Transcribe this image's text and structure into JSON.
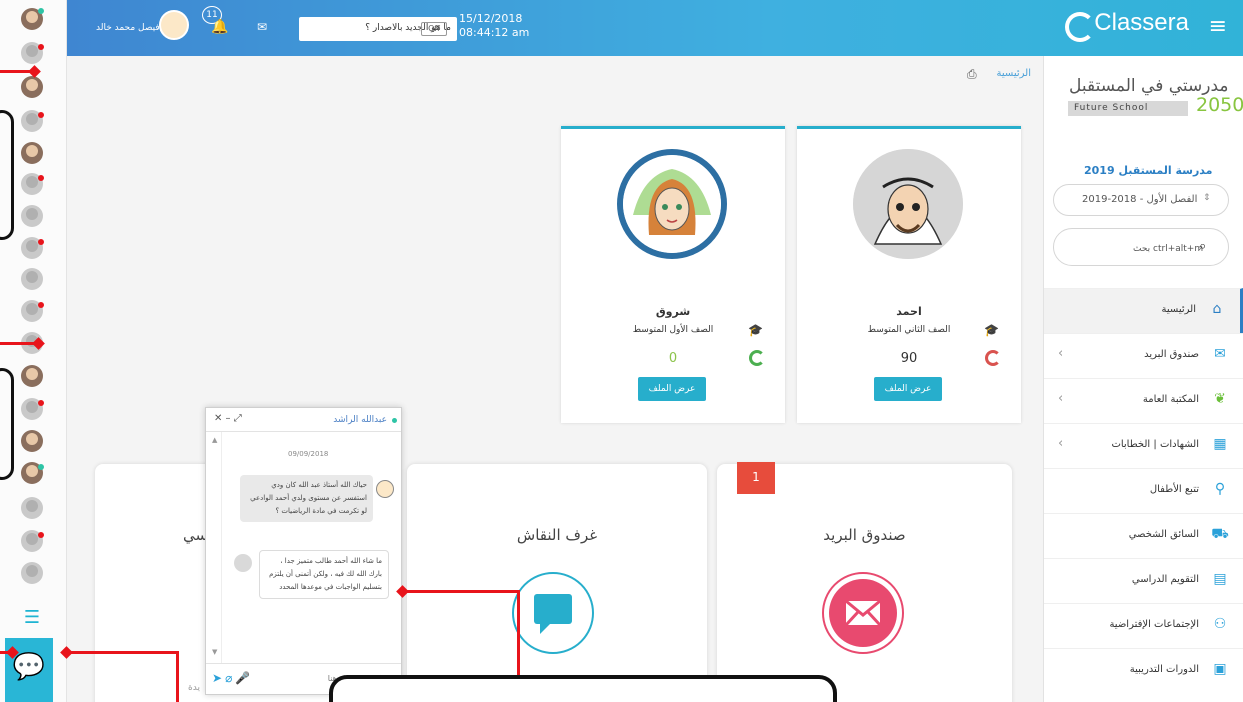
{
  "header": {
    "user_name": "فيصل محمد خالد",
    "notifications_count": "11",
    "whats_new_label": "ما هو الجديد بالاصدار ؟",
    "toggle_label": "Off",
    "date": "15/12/2018",
    "time": "08:44:12 am",
    "logo_text": "Classera",
    "accent_color": "#3fb0e0"
  },
  "sidebar": {
    "school_title_ar": "مدرستي في المستقبل",
    "school_title_en": "Future School",
    "school_year_badge": "2050",
    "school_name": "مدرسة المستقبل 2019",
    "term": "الفصل الأول - 2018-2019",
    "search_placeholder": "بحث ctrl+alt+m",
    "items": [
      {
        "label": "الرئيسية",
        "icon": "home-icon",
        "active": true
      },
      {
        "label": "صندوق البريد",
        "icon": "mail-icon"
      },
      {
        "label": "المكتبة العامة",
        "icon": "leaf-icon"
      },
      {
        "label": "الشهادات | الخطابات",
        "icon": "qr-icon"
      },
      {
        "label": "تتبع الأطفال",
        "icon": "location-pin-icon"
      },
      {
        "label": "السائق الشخصي",
        "icon": "car-icon"
      },
      {
        "label": "التقويم الدراسي",
        "icon": "calendar-icon"
      },
      {
        "label": "الإجتماعات الإفتراضية",
        "icon": "group-icon"
      },
      {
        "label": "الدورات التدريبية",
        "icon": "grid-icon"
      }
    ]
  },
  "main": {
    "breadcrumb": "الرئيسية",
    "children": [
      {
        "name": "احمد",
        "grade": "الصف الثاني المتوسط",
        "score": "90",
        "button": "عرض الملف"
      },
      {
        "name": "شروق",
        "grade": "الصف الأول المتوسط",
        "score": "0",
        "button": "عرض الملف"
      }
    ],
    "features": [
      {
        "title": "صندوق البريد",
        "badge": "1"
      },
      {
        "title": "غرف النقاش"
      },
      {
        "title": "سي"
      }
    ]
  },
  "chat": {
    "contact_name": "عبدالله الراشد",
    "date": "09/09/2018",
    "messages": [
      "حياك الله أستاذ عبد الله كان ودي استفسر عن مستوى ولدي أحمد الوادعي لو تكرمت في مادة الرياضيات ؟",
      "ما شاء الله أحمد طالب متميز جدا ، بارك الله لك فيه ، ولكن أتمنى أن يلتزم بتسليم الواجبات في موعدها المحدد"
    ],
    "input_placeholder": "اكتب رسالتك هنا ...",
    "partial_left_text": "يدة"
  }
}
